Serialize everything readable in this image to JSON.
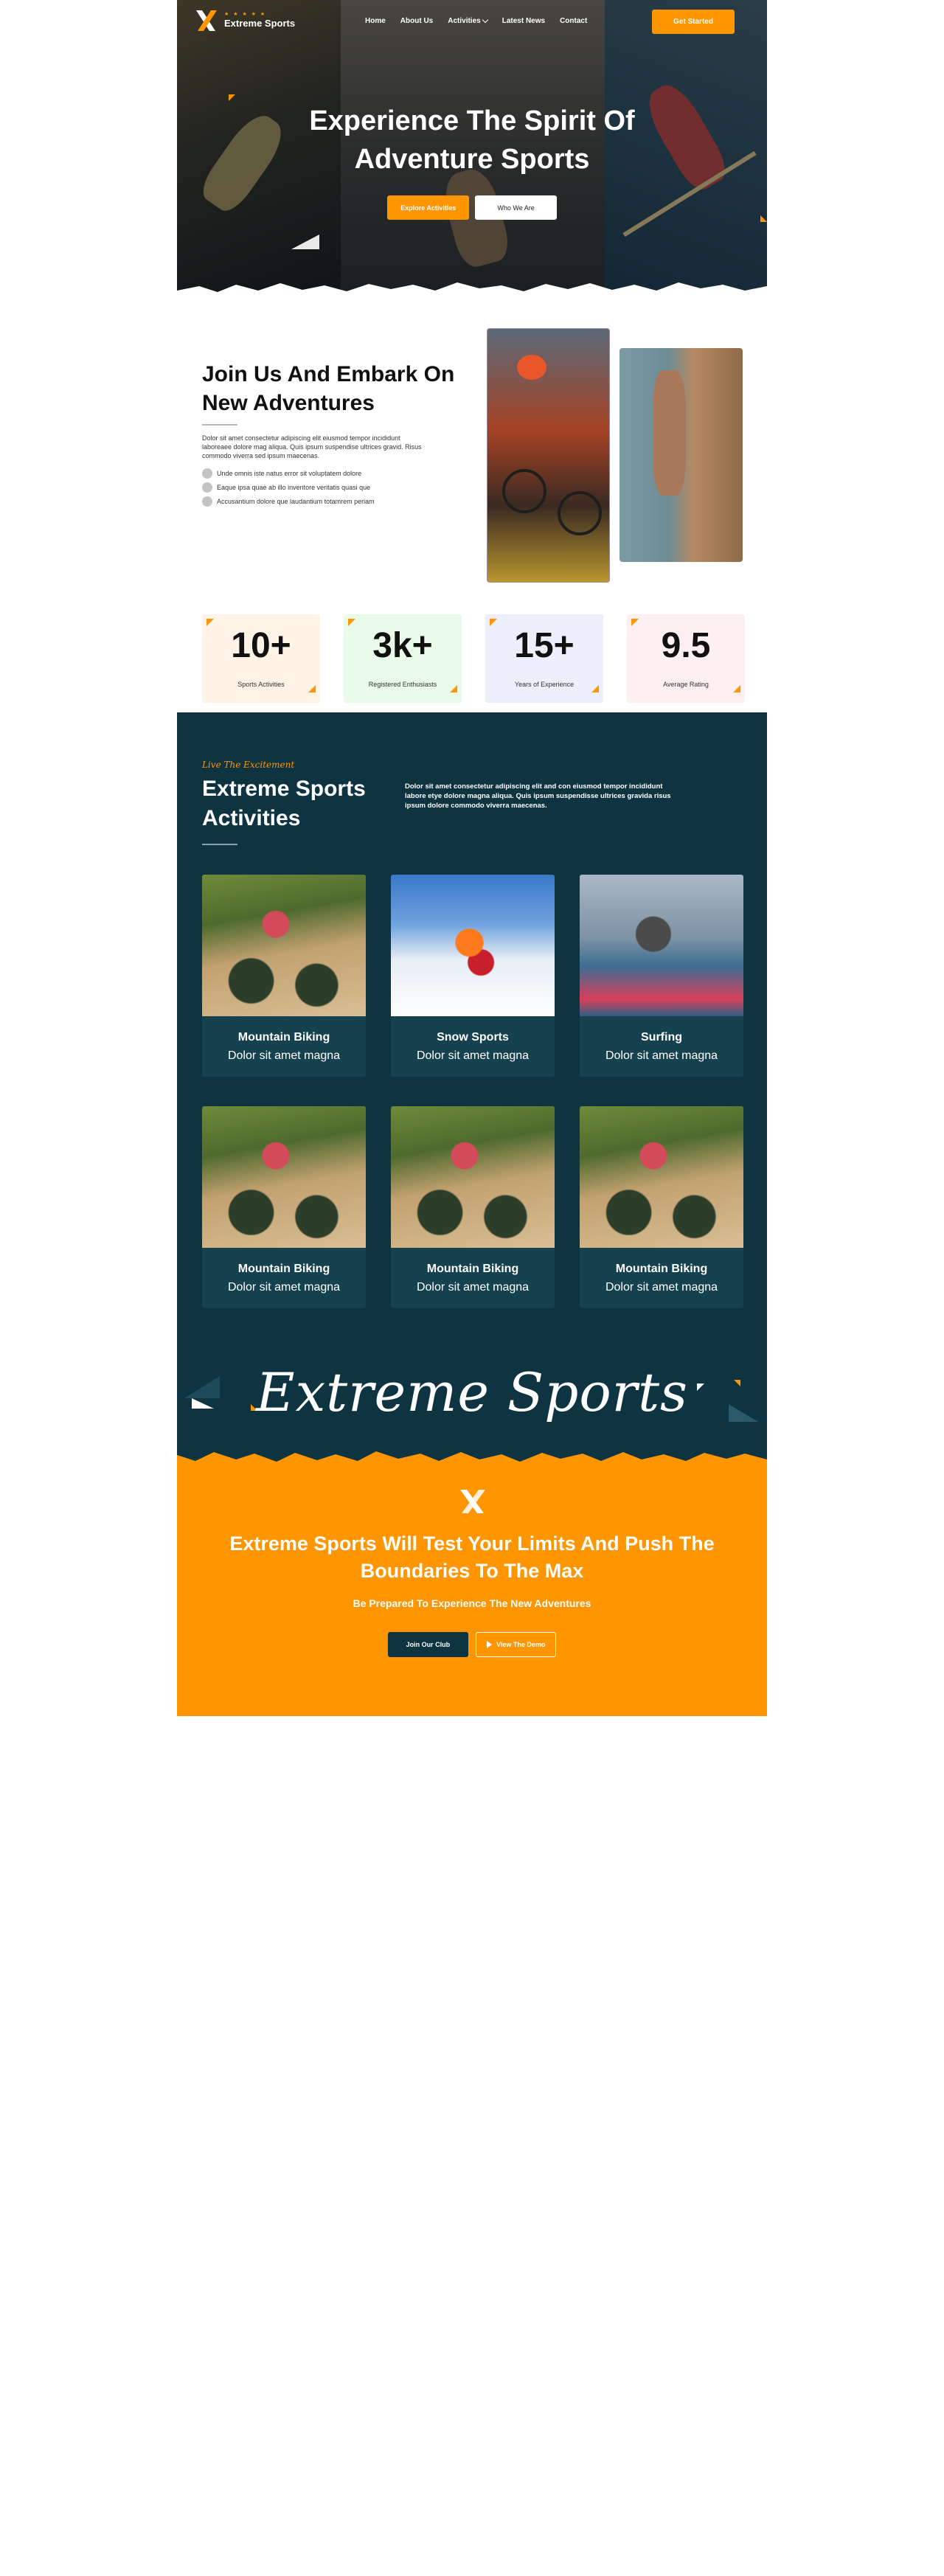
{
  "brand": {
    "stars": "★ ★ ★ ★ ★",
    "name": "Extreme Sports"
  },
  "nav": {
    "items": [
      "Home",
      "About Us",
      "Activities",
      "Latest News",
      "Contact"
    ],
    "cta": "Get Started"
  },
  "hero": {
    "title_line1": "Experience The Spirit Of",
    "title_line2": "Adventure Sports",
    "primary_button": "Explore Activities",
    "secondary_button": "Who We Are"
  },
  "join": {
    "title": "Join Us And Embark On New Adventures",
    "paragraph": "Dolor sit amet consectetur adipiscing elit eiusmod tempor incididunt laboreaee dolore mag aliqua. Quis ipsum suspendise ultrices gravid. Risus commodo viverra sed ipsum maecenas.",
    "list": [
      "Unde omnis iste natus error sit voluptatem dolore",
      "Eaque ipsa quae ab illo inventore veritatis quasi que",
      "Accusantium dolore que laudantium totamrem periam"
    ]
  },
  "stats": [
    {
      "number": "10+",
      "label": "Sports Activities",
      "bg": "#fef3e6"
    },
    {
      "number": "3k+",
      "label": "Registered Enthusiasts",
      "bg": "#e9fae9"
    },
    {
      "number": "15+",
      "label": "Years of Experience",
      "bg": "#eeeffc"
    },
    {
      "number": "9.5",
      "label": "Average Rating",
      "bg": "#fdeff2"
    }
  ],
  "activities": {
    "eyebrow": "Live The Excitement",
    "title": "Extreme Sports Activities",
    "description": "Dolor sit amet consectetur adipiscing elit and con eiusmod tempor incididunt labore etye dolore magna aliqua. Quis ipsum suspendisse ultrices gravida risus ipsum dolore commodo viverra maecenas.",
    "cards": [
      {
        "title": "Mountain Biking",
        "subtitle": "Dolor sit amet magna",
        "image": "moto"
      },
      {
        "title": "Snow Sports",
        "subtitle": "Dolor sit amet magna",
        "image": "snow"
      },
      {
        "title": "Surfing",
        "subtitle": "Dolor sit amet magna",
        "image": "surf"
      },
      {
        "title": "Mountain Biking",
        "subtitle": "Dolor sit amet magna",
        "image": "moto"
      },
      {
        "title": "Mountain Biking",
        "subtitle": "Dolor sit amet magna",
        "image": "moto"
      },
      {
        "title": "Mountain Biking",
        "subtitle": "Dolor sit amet magna",
        "image": "moto"
      }
    ],
    "script_text": "Extreme Sports"
  },
  "cta": {
    "title_line1": "Extreme Sports Will Test Your Limits And Push The",
    "title_line2": "Boundaries To The Max",
    "subtitle": "Be Prepared To Experience The New Adventures",
    "primary_button": "Join Our Club",
    "secondary_button": "View The Demo"
  },
  "colors": {
    "accent": "#ff9500",
    "dark": "#0e3442",
    "card": "#16414f"
  }
}
